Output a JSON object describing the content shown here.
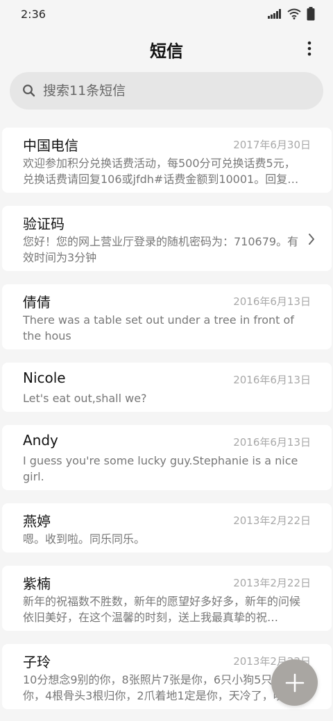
{
  "status_bar": {
    "time": "2:36",
    "icons": [
      "signal-icon",
      "wifi-icon",
      "battery-icon"
    ]
  },
  "header": {
    "title": "短信",
    "menu_icon": "more-vertical-icon"
  },
  "search": {
    "placeholder": "搜索11条短信",
    "icon": "search-icon"
  },
  "messages": [
    {
      "name": "中国电信",
      "date": "2017年6月30日",
      "preview": "欢迎参加积分兑换话费活动，每500分可兑换话费5元，兑换话费请回复106或jfdh#话费金额到10001。回复…"
    },
    {
      "name": "验证码",
      "date": "",
      "preview": "您好！您的网上营业厅登录的随机密码为：710679。有效时间为3分钟"
    },
    {
      "name": "倩倩",
      "date": "2016年6月13日",
      "preview": "There was a table set out under a tree in front of the hous"
    },
    {
      "name": "Nicole",
      "date": "2016年6月13日",
      "preview": "Let's eat out,shall we?"
    },
    {
      "name": "Andy",
      "date": "2016年6月13日",
      "preview": "I guess you're some lucky guy.Stephanie is a nice girl."
    },
    {
      "name": "燕婷",
      "date": "2013年2月22日",
      "preview": "嗯。收到啦。同乐同乐。"
    },
    {
      "name": "紫楠",
      "date": "2013年2月22日",
      "preview": "新年的祝福数不胜数，新年的愿望好多好多，新年的问候依旧美好，在这个温馨的时刻，送上我最真挚的祝…"
    },
    {
      "name": "子玲",
      "date": "2013年2月22日",
      "preview": "10分想念9别的你，8张照片7张是你，6只小狗5只像你，4根骨头3根归你，2爪着地1定是你，天冷了，唠…"
    }
  ],
  "fab": {
    "icon": "plus-icon"
  },
  "colors": {
    "background": "#f5f5f5",
    "card": "#ffffff",
    "search_bg": "#e6e6e6",
    "fab": "#a9a6a2",
    "date": "#a8a8a8",
    "preview": "#777777"
  }
}
